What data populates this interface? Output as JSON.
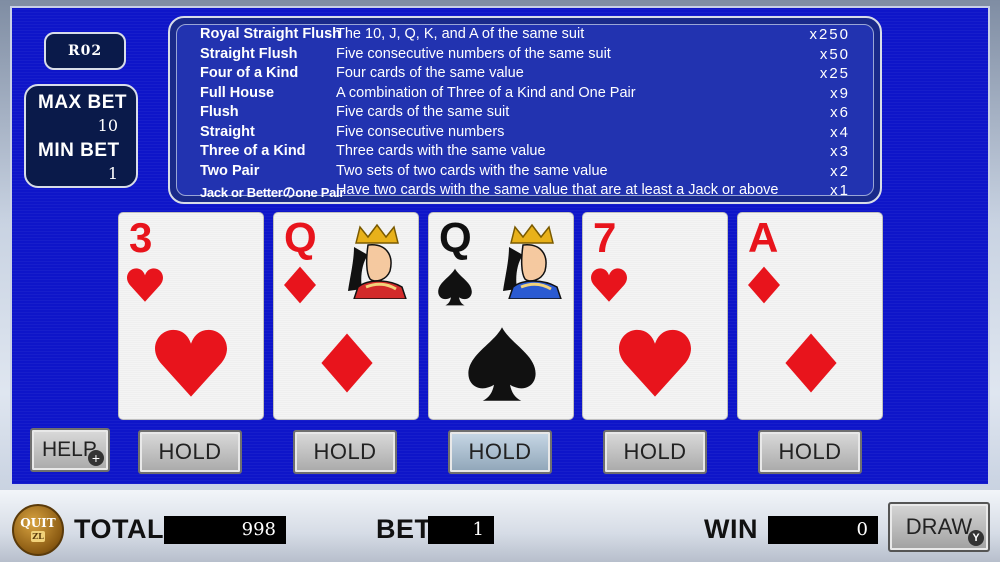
{
  "round": "R02",
  "bet_limits": {
    "max_label": "MAX BET",
    "max_value": "10",
    "min_label": "MIN BET",
    "min_value": "1"
  },
  "paytable": [
    {
      "hand": "Royal Straight Flush",
      "desc": "The 10, J, Q, K, and A of the same suit",
      "mult": "x250"
    },
    {
      "hand": "Straight Flush",
      "desc": "Five consecutive numbers of the same suit",
      "mult": "x50"
    },
    {
      "hand": "Four of a Kind",
      "desc": "Four cards of the same value",
      "mult": "x25"
    },
    {
      "hand": "Full House",
      "desc": "A combination of Three of a Kind and One Pair",
      "mult": "x9"
    },
    {
      "hand": "Flush",
      "desc": "Five cards of the same suit",
      "mult": "x6"
    },
    {
      "hand": "Straight",
      "desc": "Five consecutive numbers",
      "mult": "x4"
    },
    {
      "hand": "Three of a Kind",
      "desc": "Three cards with the same value",
      "mult": "x3"
    },
    {
      "hand": "Two Pair",
      "desc": "Two sets of two cards with the same value",
      "mult": "x2"
    },
    {
      "hand": "Jack or Betterのone Pair",
      "desc": "Have two cards with the same value that are at least a Jack or above",
      "mult": "x1"
    }
  ],
  "cards": [
    {
      "rank": "3",
      "suit": "heart",
      "color": "#e8141c"
    },
    {
      "rank": "Q",
      "suit": "diamond",
      "color": "#e8141c"
    },
    {
      "rank": "Q",
      "suit": "spade",
      "color": "#111111"
    },
    {
      "rank": "7",
      "suit": "heart",
      "color": "#e8141c"
    },
    {
      "rank": "A",
      "suit": "diamond",
      "color": "#e8141c"
    }
  ],
  "buttons": {
    "help": "HELP",
    "hold": "HOLD",
    "draw": "DRAW",
    "quit": "QUIT",
    "help_badge": "+",
    "draw_badge": "Y",
    "quit_badge": "ZL"
  },
  "status": {
    "total_label": "TOTAL",
    "total_value": "998",
    "bet_label": "BET",
    "bet_value": "1",
    "win_label": "WIN",
    "win_value": "0"
  }
}
